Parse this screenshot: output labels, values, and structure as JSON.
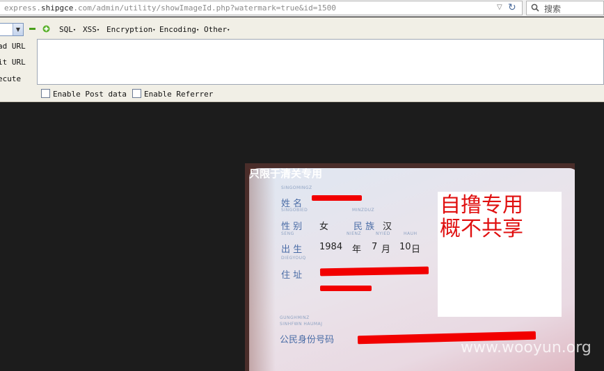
{
  "urlbar": {
    "url_prefix": "express.",
    "url_domain": "shipgce",
    "url_suffix": ".com/admin/utility/showImageId.php?watermark=true&id=1500",
    "search_placeholder": "搜索"
  },
  "hackbar": {
    "menus": [
      "SQL",
      "XSS",
      "Encryption",
      "Encoding",
      "Other"
    ],
    "side_labels": [
      "ad URL",
      "it URL",
      "ecute"
    ],
    "enable_post": "Enable Post data",
    "enable_referrer": "Enable Referrer"
  },
  "image": {
    "watermark_top": "只限于清关专用",
    "card": {
      "name_label": "姓 名",
      "gender_label": "性 别",
      "gender_value": "女",
      "ethnicity_label": "民 族",
      "ethnicity_value": "汉",
      "birth_label": "出 生",
      "birth_year": "1984",
      "birth_year_unit": "年",
      "birth_month": "7",
      "birth_month_unit": "月",
      "birth_day": "10",
      "birth_day_unit": "日",
      "address_label": "住 址",
      "id_label": "公民身份号码",
      "small_singomingz": "SINGOMINGZ",
      "small_singobied": "SINGOBIED",
      "small_minzduz": "MINZDUZ",
      "small_seng": "SENG",
      "small_nienz": "NIENZ",
      "small_nyied": "NYIED",
      "small_hauh": "HAUH",
      "small_diegyoug": "DIEGYOUQ",
      "small_gunghminz": "GUNGHMINZ",
      "small_sinhfwn": "SINHFWN HAUMAJ"
    },
    "overlay_line1": "自撸专用",
    "overlay_line2": "概不共享",
    "site_watermark": "www.wooyun.org"
  }
}
